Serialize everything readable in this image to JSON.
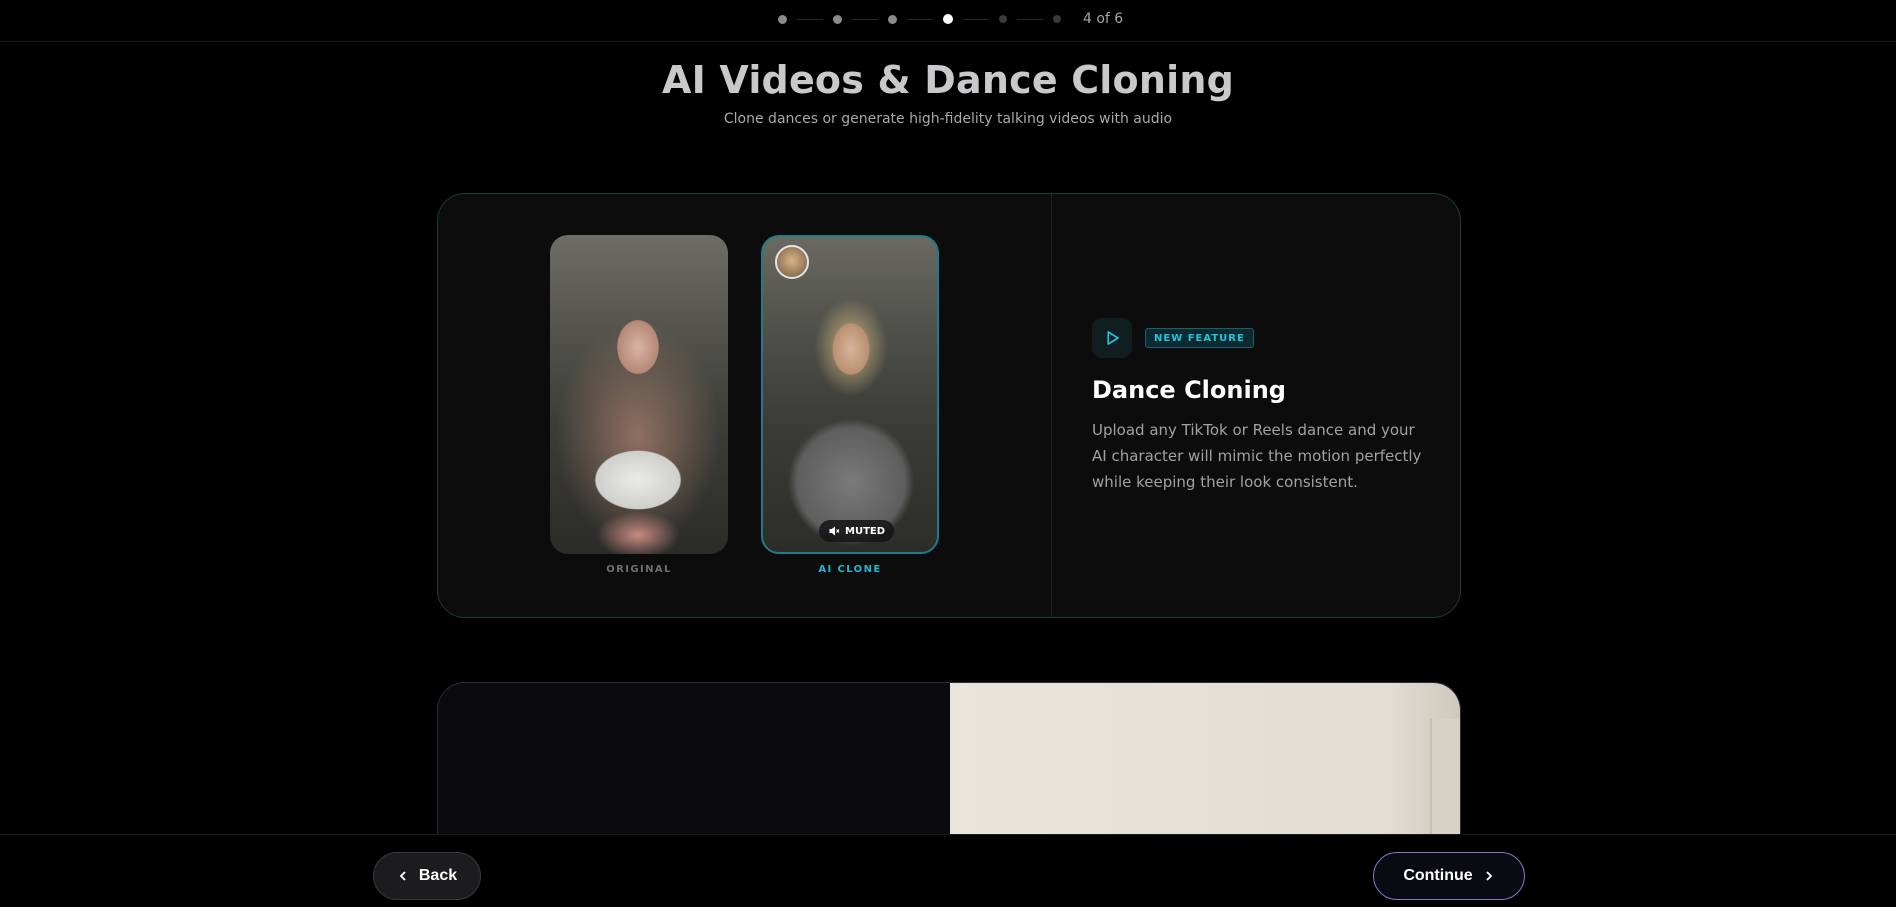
{
  "progress": {
    "total_steps": 6,
    "current_step": 4,
    "label": "4 of 6"
  },
  "header": {
    "title": "AI Videos & Dance Cloning",
    "subtitle": "Clone dances or generate high-fidelity talking videos with audio"
  },
  "feature_card": {
    "original_label": "ORIGINAL",
    "clone_label": "AI CLONE",
    "muted_label": "MUTED",
    "play_icon": "play-icon",
    "tag": "NEW FEATURE",
    "title": "Dance Cloning",
    "description": "Upload any TikTok or Reels dance and your AI character will mimic the motion perfectly while keeping their look consistent."
  },
  "footer": {
    "back_label": "Back",
    "continue_label": "Continue"
  },
  "colors": {
    "accent_cyan": "#1fc5e0",
    "continue_border": "#7e7bd2",
    "card_border": "#1d3b3c"
  }
}
